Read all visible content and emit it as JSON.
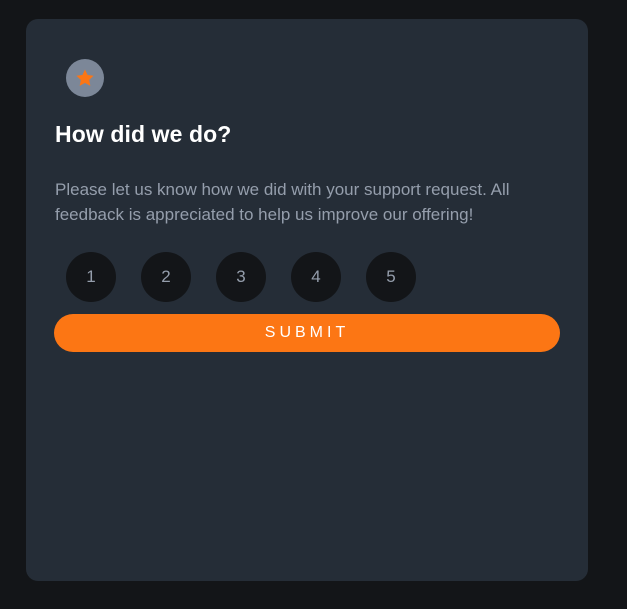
{
  "card": {
    "icon": "star-icon",
    "title": "How did we do?",
    "description": "Please let us know how we did with your support request. All feedback is appreciated to help us improve our offering!",
    "ratings": [
      "1",
      "2",
      "3",
      "4",
      "5"
    ],
    "submit_label": "SUBMIT"
  },
  "colors": {
    "page_background": "#131518",
    "card_background": "#252d37",
    "accent": "#fc7614",
    "muted_text": "#959eac",
    "badge_background": "#7c8798"
  }
}
